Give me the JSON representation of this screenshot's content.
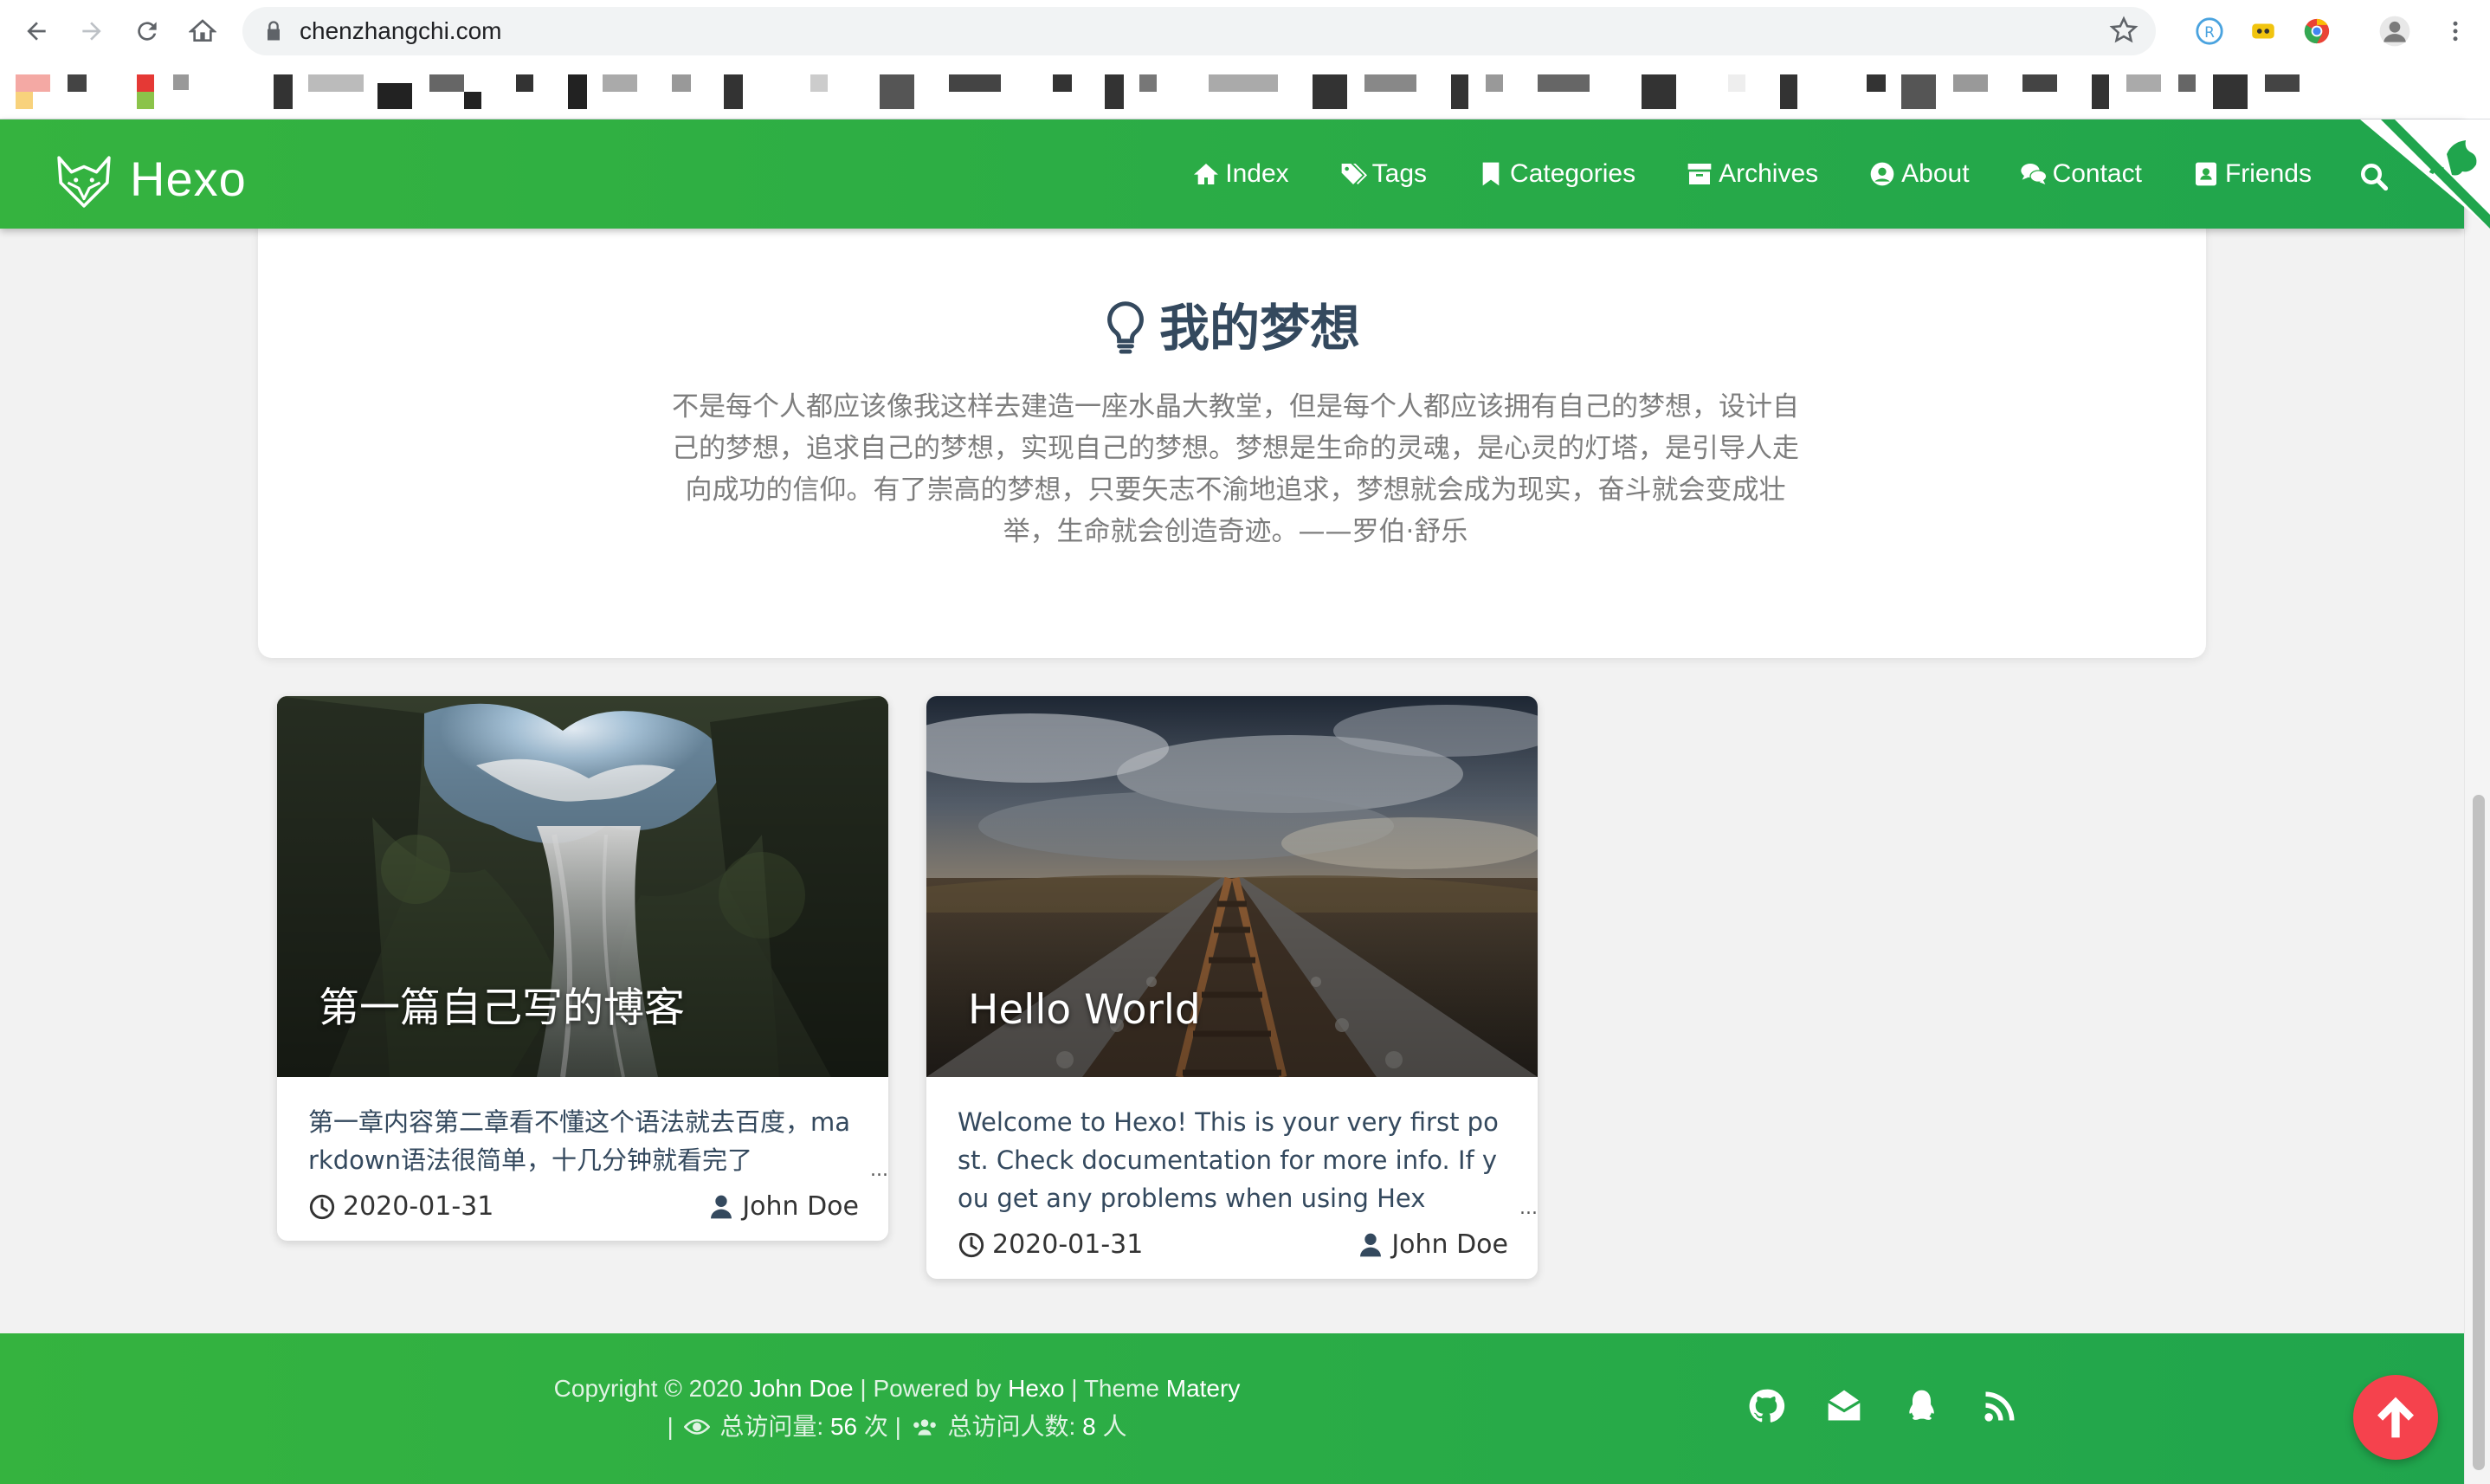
{
  "browser": {
    "url": "chenzhangchi.com"
  },
  "site": {
    "logo_text": "Hexo",
    "menu": [
      {
        "label": "Index",
        "icon": "home-icon"
      },
      {
        "label": "Tags",
        "icon": "tags-icon"
      },
      {
        "label": "Categories",
        "icon": "bookmark-icon"
      },
      {
        "label": "Archives",
        "icon": "archive-icon"
      },
      {
        "label": "About",
        "icon": "user-circle-icon"
      },
      {
        "label": "Contact",
        "icon": "comments-icon"
      },
      {
        "label": "Friends",
        "icon": "address-book-icon"
      }
    ]
  },
  "dream": {
    "title": "我的梦想",
    "text": "不是每个人都应该像我这样去建造一座水晶大教堂，但是每个人都应该拥有自己的梦想，设计自己的梦想，追求自己的梦想，实现自己的梦想。梦想是生命的灵魂，是心灵的灯塔，是引导人走向成功的信仰。有了崇高的梦想，只要矢志不渝地追求，梦想就会成为现实，奋斗就会变成壮举，生命就会创造奇迹。——罗伯·舒乐"
  },
  "articles": [
    {
      "title": "第一篇自己写的博客",
      "summary": "第一章内容第二章看不懂这个语法就去百度，markdown语法很简单，十几分钟就看完了",
      "ellipsis": "...",
      "date": "2020-01-31",
      "author": "John Doe"
    },
    {
      "title": "Hello World",
      "summary": "Welcome to Hexo! This is your very first post. Check documentation for more info. If you get any problems when using Hex",
      "ellipsis": "...",
      "date": "2020-01-31",
      "author": "John Doe"
    }
  ],
  "footer": {
    "copyright_prefix": "Copyright © 2020",
    "author": "John Doe",
    "powered_prefix": "| Powered by",
    "powered_name": "Hexo",
    "theme_prefix": "| Theme",
    "theme_name": "Matery",
    "stats_prefix": "|",
    "visits_label": "总访问量:",
    "visits_count": "56",
    "visits_unit": "次",
    "stats_separator": "|",
    "visitors_label": "总访问人数:",
    "visitors_count": "8",
    "visitors_unit": "人"
  },
  "colors": {
    "header_green": "#35b33f",
    "back_to_top": "#f5424d"
  }
}
